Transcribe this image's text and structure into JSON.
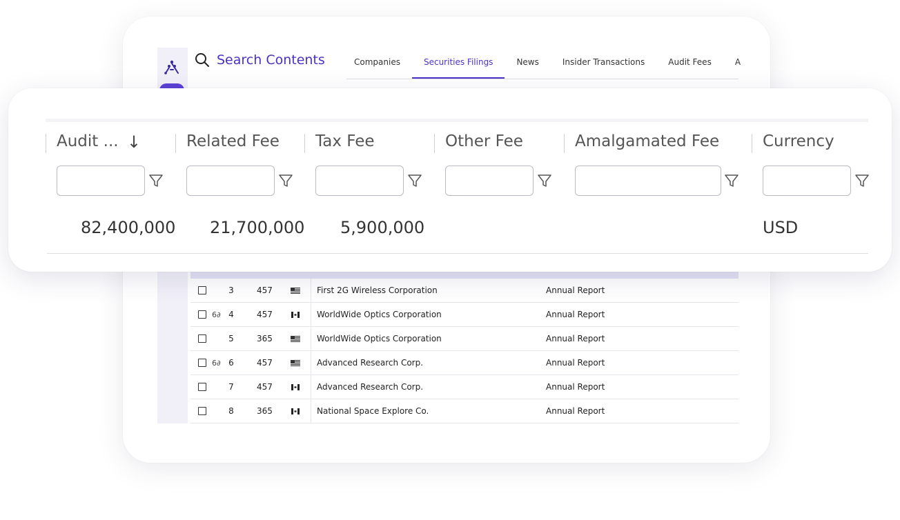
{
  "app": {
    "search_title": "Search Contents",
    "tabs": [
      {
        "label": "Companies"
      },
      {
        "label": "Securities Filings",
        "active": true
      },
      {
        "label": "News"
      },
      {
        "label": "Insider Transactions"
      },
      {
        "label": "Audit Fees"
      },
      {
        "label": "A"
      }
    ]
  },
  "table": {
    "rows": [
      {
        "num": "3",
        "val": "457",
        "flag": "us-flag-icon",
        "company": "First 2G Wireless Corporation",
        "type": "Annual Report",
        "viewed": false
      },
      {
        "num": "4",
        "val": "457",
        "flag": "ca-flag-icon",
        "company": "WorldWide Optics Corporation",
        "type": "Annual Report",
        "viewed": true
      },
      {
        "num": "5",
        "val": "365",
        "flag": "us-flag-icon",
        "company": "WorldWide Optics Corporation",
        "type": "Annual Report",
        "viewed": false
      },
      {
        "num": "6",
        "val": "457",
        "flag": "us-flag-icon",
        "company": "Advanced Research Corp.",
        "type": "Annual Report",
        "viewed": true
      },
      {
        "num": "7",
        "val": "457",
        "flag": "ca-flag-icon",
        "company": "Advanced Research Corp.",
        "type": "Annual Report",
        "viewed": false
      },
      {
        "num": "8",
        "val": "365",
        "flag": "ca-flag-icon",
        "company": "National Space Explore Co.",
        "type": "Annual Report",
        "viewed": false
      }
    ],
    "viewed_glyph": "6∂"
  },
  "overlay": {
    "sort_glyph": "↓",
    "columns": [
      {
        "title": "Audit ...",
        "value": "82,400,000",
        "sorted": true
      },
      {
        "title": "Related Fee",
        "value": "21,700,000"
      },
      {
        "title": "Tax Fee",
        "value": "5,900,000"
      },
      {
        "title": "Other Fee",
        "value": ""
      },
      {
        "title": "Amalgamated Fee",
        "value": ""
      },
      {
        "title": "Currency",
        "value": "USD"
      }
    ]
  },
  "colors": {
    "accent": "#4a31c9",
    "rail": "#f1f0f8",
    "header_strip": "#e4e2f4"
  }
}
